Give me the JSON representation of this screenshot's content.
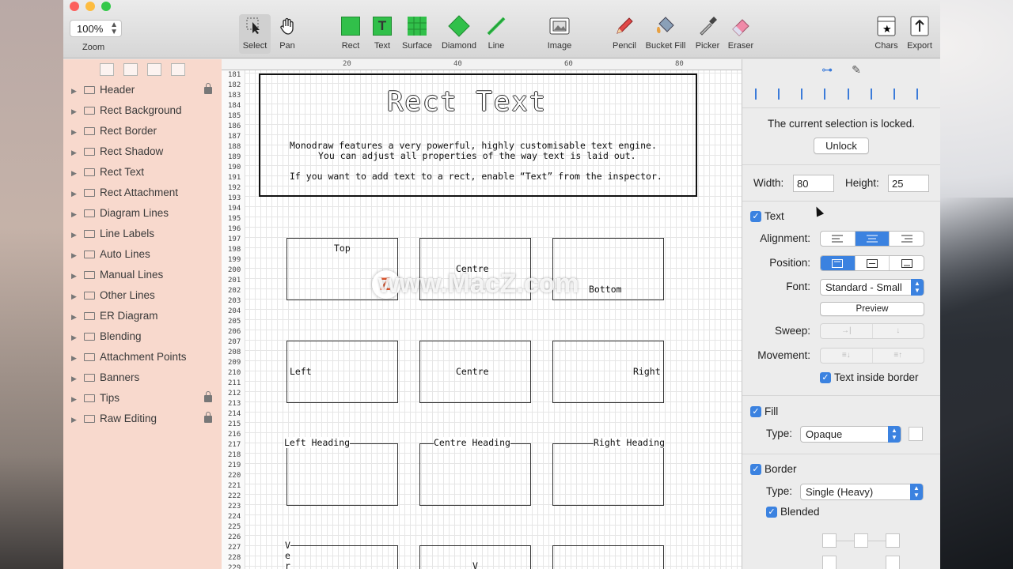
{
  "toolbar": {
    "zoom_value": "100%",
    "zoom_label": "Zoom",
    "tools": [
      {
        "label": "Select",
        "icon": "select-arrow-icon",
        "selected": true
      },
      {
        "label": "Pan",
        "icon": "hand-icon"
      },
      {
        "label": "Rect",
        "icon": "rect-icon"
      },
      {
        "label": "Text",
        "icon": "text-icon"
      },
      {
        "label": "Surface",
        "icon": "grid-icon"
      },
      {
        "label": "Diamond",
        "icon": "diamond-icon"
      },
      {
        "label": "Line",
        "icon": "line-icon"
      },
      {
        "label": "Image",
        "icon": "image-icon"
      },
      {
        "label": "Pencil",
        "icon": "pencil-icon"
      },
      {
        "label": "Bucket Fill",
        "icon": "bucket-icon"
      },
      {
        "label": "Picker",
        "icon": "eyedropper-icon"
      },
      {
        "label": "Eraser",
        "icon": "eraser-icon"
      },
      {
        "label": "Chars",
        "icon": "chars-icon"
      },
      {
        "label": "Export",
        "icon": "export-icon"
      }
    ]
  },
  "sidebar": {
    "layers": [
      {
        "label": "Header",
        "locked": true
      },
      {
        "label": "Rect Background",
        "locked": false
      },
      {
        "label": "Rect Border",
        "locked": false
      },
      {
        "label": "Rect Shadow",
        "locked": false
      },
      {
        "label": "Rect Text",
        "locked": false
      },
      {
        "label": "Rect Attachment",
        "locked": false
      },
      {
        "label": "Diagram Lines",
        "locked": false
      },
      {
        "label": "Line Labels",
        "locked": false
      },
      {
        "label": "Auto Lines",
        "locked": false
      },
      {
        "label": "Manual Lines",
        "locked": false
      },
      {
        "label": "Other Lines",
        "locked": false
      },
      {
        "label": "ER Diagram",
        "locked": false
      },
      {
        "label": "Blending",
        "locked": false
      },
      {
        "label": "Attachment Points",
        "locked": false
      },
      {
        "label": "Banners",
        "locked": false
      },
      {
        "label": "Tips",
        "locked": true
      },
      {
        "label": "Raw Editing",
        "locked": true
      }
    ]
  },
  "canvas": {
    "ruler_marks": [
      "20",
      "40",
      "60",
      "80"
    ],
    "line_numbers": [
      "181",
      "182",
      "183",
      "184",
      "185",
      "186",
      "187",
      "188",
      "189",
      "190",
      "191",
      "192",
      "193",
      "194",
      "195",
      "196",
      "197",
      "198",
      "199",
      "200",
      "201",
      "202",
      "203",
      "204",
      "205",
      "206",
      "207",
      "208",
      "209",
      "210",
      "211",
      "212",
      "213",
      "214",
      "215",
      "216",
      "217",
      "218",
      "219",
      "220",
      "221",
      "222",
      "223",
      "224",
      "225",
      "226",
      "227",
      "228",
      "229"
    ],
    "banner_text": "Rect Text",
    "body_line1": "Monodraw features a very powerful, highly customisable text engine.",
    "body_line2": "You can adjust all properties of the way text is laid out.",
    "body_line3": "If you want to add text to a rect, enable “Text” from the inspector.",
    "box_top": "Top",
    "box_centre": "Centre",
    "box_bottom": "Bottom",
    "box_left": "Left",
    "box_centre2": "Centre",
    "box_right": "Right",
    "heading_left": "Left Heading",
    "heading_centre": "Centre Heading",
    "heading_right": "Right Heading",
    "vertical_chars": [
      "V",
      "e",
      "r"
    ],
    "vertical_v": "V",
    "watermark": "www.MacZ.com"
  },
  "inspector": {
    "locked_msg": "The current selection is locked.",
    "unlock_label": "Unlock",
    "width_label": "Width:",
    "width_value": "80",
    "height_label": "Height:",
    "height_value": "25",
    "text_label": "Text",
    "alignment_label": "Alignment:",
    "position_label": "Position:",
    "font_label": "Font:",
    "font_value": "Standard - Small",
    "preview_label": "Preview",
    "sweep_label": "Sweep:",
    "movement_label": "Movement:",
    "text_inside_border": "Text inside border",
    "fill_label": "Fill",
    "fill_type_label": "Type:",
    "fill_type_value": "Opaque",
    "border_label": "Border",
    "border_type_label": "Type:",
    "border_type_value": "Single (Heavy)",
    "blended_label": "Blended"
  },
  "colors": {
    "accent": "#3b82e0",
    "sidebar_bg": "#f8d9cd"
  }
}
